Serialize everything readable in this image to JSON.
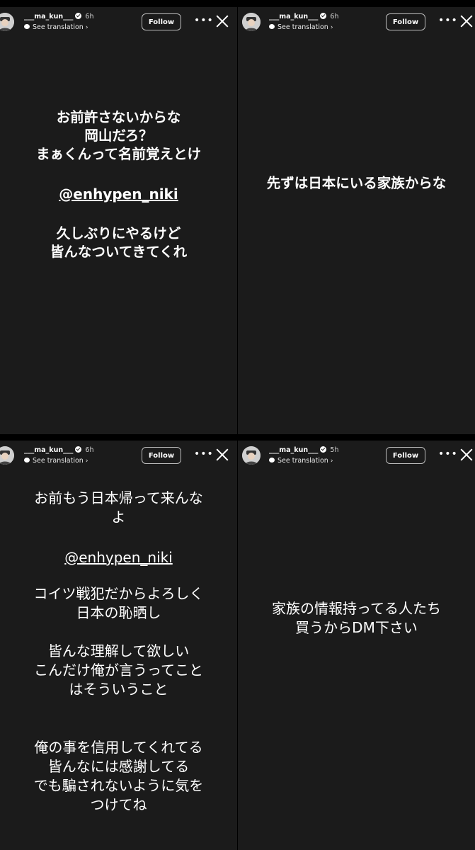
{
  "stories": [
    {
      "username": "___ma_kun___",
      "time": "6h",
      "see_translation": "See translation",
      "follow_label": "Follow",
      "lines": [
        "お前許さないからな",
        "岡山だろ？",
        "まぁくんって名前覚えとけ"
      ],
      "mention": "@enhypen_niki",
      "lines2": [
        "久しぶりにやるけど",
        "皆んなついてきてくれ"
      ]
    },
    {
      "username": "___ma_kun___",
      "time": "6h",
      "see_translation": "See translation",
      "follow_label": "Follow",
      "lines": [
        "先ずは日本にいる家族からな"
      ]
    },
    {
      "username": "___ma_kun___",
      "time": "6h",
      "see_translation": "See translation",
      "follow_label": "Follow",
      "lines": [
        "お前もう日本帰って来んな",
        "よ"
      ],
      "mention": "@enhypen_niki",
      "lines2": [
        "コイツ戦犯だからよろしく",
        "日本の恥晒し"
      ],
      "lines3": [
        "皆んな理解して欲しい",
        "こんだけ俺が言うってこと",
        "はそういうこと"
      ],
      "lines4": [
        "俺の事を信用してくれてる",
        "皆んなには感謝してる",
        "でも騙されないように気を",
        "つけてね"
      ]
    },
    {
      "username": "___ma_kun___",
      "time": "5h",
      "see_translation": "See translation",
      "follow_label": "Follow",
      "lines": [
        "家族の情報持ってる人たち",
        "買うからDM下さい"
      ]
    }
  ]
}
